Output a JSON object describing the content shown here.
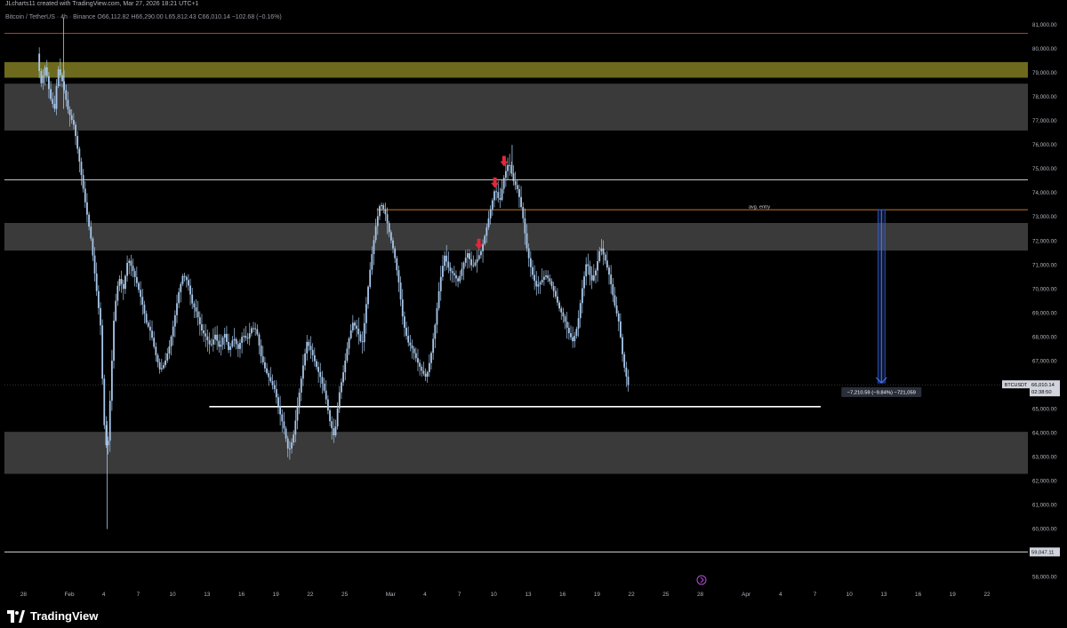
{
  "header": {
    "created_by": "JLcharts11 created with TradingView.com, Mar 27, 2026 18:21 UTC+1"
  },
  "symbol_line": {
    "name": "Bitcoin / TetherUS · 4h · Binance",
    "o": "O66,112.82",
    "h": "H66,290.00",
    "l": "L65,812.43",
    "c": "C66,010.14",
    "chg": "−102.68 (−0.16%)"
  },
  "branding": {
    "name": "TradingView"
  },
  "colors": {
    "background": "#000000",
    "candle": "#a7c7ea",
    "zone_gray": "#3a3a3a",
    "zone_olive": "#6d6a1e",
    "resistance_line": "#b23a3a",
    "entry_line": "#c8762b",
    "arrow": "#e0283b",
    "measure": "#2f5bd8",
    "price_tag": "#d1d4dc"
  },
  "chart_data": {
    "type": "candlestick",
    "title": "Bitcoin / TetherUS · 4h · Binance",
    "ylim": [
      57300,
      81900
    ],
    "y_ticks": [
      58000,
      59000,
      60000,
      61000,
      62000,
      63000,
      64000,
      65000,
      66000,
      67000,
      68000,
      69000,
      70000,
      71000,
      72000,
      73000,
      74000,
      75000,
      76000,
      77000,
      78000,
      79000,
      80000,
      81000
    ],
    "y_tick_labels": [
      "58,000.00",
      "59,000.00",
      "60,000.00",
      "61,000.00",
      "62,000.00",
      "63,000.00",
      "64,000.00",
      "65,000.00",
      "66,000.00",
      "67,000.00",
      "68,000.00",
      "69,000.00",
      "70,000.00",
      "71,000.00",
      "72,000.00",
      "73,000.00",
      "74,000.00",
      "75,000.00",
      "76,000.00",
      "77,000.00",
      "78,000.00",
      "79,000.00",
      "80,000.00",
      "81,000.00"
    ],
    "x_ticks": [
      {
        "label": "28",
        "day": -4
      },
      {
        "label": "Feb",
        "day": 0
      },
      {
        "label": "4",
        "day": 3
      },
      {
        "label": "7",
        "day": 6
      },
      {
        "label": "10",
        "day": 9
      },
      {
        "label": "13",
        "day": 12
      },
      {
        "label": "16",
        "day": 15
      },
      {
        "label": "19",
        "day": 18
      },
      {
        "label": "22",
        "day": 21
      },
      {
        "label": "25",
        "day": 24
      },
      {
        "label": "Mar",
        "day": 28
      },
      {
        "label": "4",
        "day": 31
      },
      {
        "label": "7",
        "day": 34
      },
      {
        "label": "10",
        "day": 37
      },
      {
        "label": "13",
        "day": 40
      },
      {
        "label": "16",
        "day": 43
      },
      {
        "label": "19",
        "day": 46
      },
      {
        "label": "22",
        "day": 49
      },
      {
        "label": "25",
        "day": 52
      },
      {
        "label": "28",
        "day": 55
      },
      {
        "label": "Apr",
        "day": 59
      },
      {
        "label": "4",
        "day": 62
      },
      {
        "label": "7",
        "day": 65
      },
      {
        "label": "10",
        "day": 68
      },
      {
        "label": "13",
        "day": 71
      },
      {
        "label": "16",
        "day": 74
      },
      {
        "label": "19",
        "day": 77
      },
      {
        "label": "22",
        "day": 80
      }
    ],
    "price_path": [
      [
        -2.7,
        79800
      ],
      [
        -2.4,
        78500
      ],
      [
        -2.0,
        79300
      ],
      [
        -1.6,
        78000
      ],
      [
        -1.2,
        77500
      ],
      [
        -0.9,
        79200
      ],
      [
        -0.5,
        78600
      ],
      [
        0.0,
        77400
      ],
      [
        0.5,
        76800
      ],
      [
        1.0,
        75200
      ],
      [
        1.5,
        73500
      ],
      [
        2.0,
        72000
      ],
      [
        2.4,
        70200
      ],
      [
        2.8,
        68500
      ],
      [
        3.1,
        64500
      ],
      [
        3.4,
        63000
      ],
      [
        3.7,
        66000
      ],
      [
        4.0,
        69000
      ],
      [
        4.4,
        70500
      ],
      [
        4.8,
        70000
      ],
      [
        5.2,
        71300
      ],
      [
        5.6,
        70800
      ],
      [
        6.0,
        70200
      ],
      [
        6.4,
        69500
      ],
      [
        6.8,
        68600
      ],
      [
        7.2,
        68200
      ],
      [
        7.6,
        67300
      ],
      [
        8.0,
        66600
      ],
      [
        8.4,
        66900
      ],
      [
        8.8,
        67600
      ],
      [
        9.2,
        68600
      ],
      [
        9.6,
        69800
      ],
      [
        10.0,
        70600
      ],
      [
        10.4,
        70300
      ],
      [
        10.8,
        69400
      ],
      [
        11.2,
        69000
      ],
      [
        11.6,
        68300
      ],
      [
        12.0,
        68000
      ],
      [
        12.4,
        67600
      ],
      [
        12.8,
        68100
      ],
      [
        13.2,
        67500
      ],
      [
        13.6,
        68200
      ],
      [
        14.0,
        67400
      ],
      [
        14.4,
        68000
      ],
      [
        14.8,
        67500
      ],
      [
        15.2,
        68100
      ],
      [
        15.6,
        67900
      ],
      [
        16.0,
        68400
      ],
      [
        16.4,
        68300
      ],
      [
        16.8,
        67200
      ],
      [
        17.2,
        66600
      ],
      [
        17.6,
        66200
      ],
      [
        18.0,
        65800
      ],
      [
        18.4,
        64900
      ],
      [
        18.8,
        64200
      ],
      [
        19.2,
        63200
      ],
      [
        19.6,
        63800
      ],
      [
        20.0,
        65200
      ],
      [
        20.4,
        66600
      ],
      [
        20.8,
        67800
      ],
      [
        21.2,
        67400
      ],
      [
        21.6,
        66800
      ],
      [
        22.0,
        66300
      ],
      [
        22.4,
        65600
      ],
      [
        22.8,
        64500
      ],
      [
        23.2,
        63800
      ],
      [
        23.6,
        65600
      ],
      [
        24.0,
        66600
      ],
      [
        24.4,
        67800
      ],
      [
        24.8,
        68600
      ],
      [
        25.2,
        68300
      ],
      [
        25.6,
        67600
      ],
      [
        26.0,
        69500
      ],
      [
        26.4,
        71200
      ],
      [
        26.8,
        72600
      ],
      [
        27.2,
        73600
      ],
      [
        27.6,
        73200
      ],
      [
        28.0,
        72300
      ],
      [
        28.4,
        71500
      ],
      [
        28.8,
        70300
      ],
      [
        29.2,
        68600
      ],
      [
        29.6,
        67800
      ],
      [
        30.0,
        67500
      ],
      [
        30.4,
        67000
      ],
      [
        30.8,
        66600
      ],
      [
        31.2,
        66300
      ],
      [
        31.6,
        67200
      ],
      [
        32.0,
        68600
      ],
      [
        32.4,
        70300
      ],
      [
        32.8,
        71400
      ],
      [
        33.2,
        70800
      ],
      [
        33.6,
        70600
      ],
      [
        34.0,
        70300
      ],
      [
        34.4,
        71000
      ],
      [
        34.8,
        71500
      ],
      [
        35.2,
        70900
      ],
      [
        35.6,
        71200
      ],
      [
        36.0,
        71600
      ],
      [
        36.4,
        72400
      ],
      [
        36.8,
        73300
      ],
      [
        37.2,
        74200
      ],
      [
        37.6,
        73600
      ],
      [
        38.0,
        74700
      ],
      [
        38.4,
        75300
      ],
      [
        38.8,
        74500
      ],
      [
        39.2,
        74100
      ],
      [
        39.6,
        73100
      ],
      [
        40.0,
        71600
      ],
      [
        40.4,
        70700
      ],
      [
        40.8,
        70100
      ],
      [
        41.2,
        70300
      ],
      [
        41.6,
        70600
      ],
      [
        42.0,
        70300
      ],
      [
        42.4,
        69800
      ],
      [
        42.8,
        69200
      ],
      [
        43.2,
        68800
      ],
      [
        43.6,
        68200
      ],
      [
        44.0,
        67800
      ],
      [
        44.4,
        68500
      ],
      [
        44.8,
        70000
      ],
      [
        45.2,
        71200
      ],
      [
        45.6,
        70300
      ],
      [
        46.0,
        70800
      ],
      [
        46.4,
        71800
      ],
      [
        46.8,
        71200
      ],
      [
        47.2,
        70500
      ],
      [
        47.6,
        69400
      ],
      [
        48.0,
        68600
      ],
      [
        48.4,
        66900
      ],
      [
        48.8,
        66000
      ]
    ],
    "zones": [
      {
        "from": 79450,
        "to": 78800,
        "color": "#6d6a1e"
      },
      {
        "from": 78550,
        "to": 76600,
        "color": "#3a3a3a"
      },
      {
        "from": 72750,
        "to": 71600,
        "color": "#3a3a3a"
      },
      {
        "from": 64050,
        "to": 62300,
        "color": "#3a3a3a"
      }
    ],
    "lines": [
      {
        "price": 80650,
        "color": "#b23a3a",
        "width": 1
      },
      {
        "price": 74550,
        "color": "#d1d4dc",
        "width": 1
      },
      {
        "price": 59047.11,
        "color": "#d1d4dc",
        "width": 1
      }
    ],
    "support_segment": {
      "price": 65100,
      "from_day": 12.2,
      "to_day": 65.5
    },
    "entry_line": {
      "price": 73300,
      "from_day": 26.8,
      "label": "avg. entry"
    },
    "arrows": [
      {
        "day": 35.7,
        "price": 71650
      },
      {
        "day": 37.1,
        "price": 74200
      },
      {
        "day": 37.9,
        "price": 75100
      }
    ],
    "measure": {
      "day": 70.8,
      "from": 73300,
      "to": 66090,
      "label": "−7,210.59 (−9.84%) −721,059"
    },
    "last_price_line": 66010,
    "last_price_tag": {
      "symbol": "BTCUSDT",
      "price": "66,010.14",
      "countdown": "02:38:50"
    },
    "low_tag": "59,047.11"
  }
}
